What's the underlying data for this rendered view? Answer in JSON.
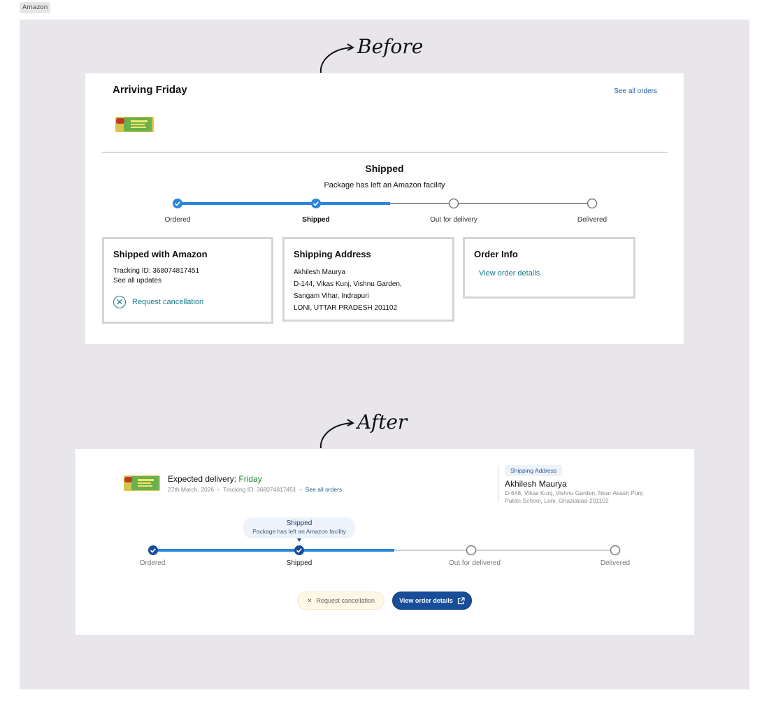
{
  "frame": {
    "label": "Amazon"
  },
  "notes": {
    "before": "Before",
    "after": "After"
  },
  "before": {
    "title": "Arriving Friday",
    "see_all": "See all orders",
    "status": "Shipped",
    "status_sub": "Package has left an Amazon facility",
    "steps": [
      {
        "label": "Ordered",
        "done": true
      },
      {
        "label": "Shipped",
        "done": true,
        "current": true
      },
      {
        "label": "Out for delivery",
        "done": false
      },
      {
        "label": "Delivered",
        "done": false
      }
    ],
    "shipped_box": {
      "title": "Shipped with Amazon",
      "tracking": "Tracking ID: 368074817451",
      "updates": "See all updates",
      "cancel": "Request cancellation"
    },
    "address_box": {
      "title": "Shipping Address",
      "lines": [
        "Akhilesh Maurya",
        "D-144, Vikas Kunj, Vishnu Garden,",
        "Sangam Vihar, Indrapuri",
        "LONI, UTTAR PRADESH 201102"
      ]
    },
    "order_box": {
      "title": "Order Info",
      "link": "View order details"
    }
  },
  "after": {
    "expected_prefix": "Expected delivery: ",
    "expected_day": "Friday",
    "date": "27th March, 2026",
    "tracking": "Tracking ID: 368074817451",
    "see_all": "See all orders",
    "address_pill": "Shipping Address",
    "name": "Akhilesh Maurya",
    "address": "D-648, Vikas Kunj, Vishnu Garden, Near Akash Punj Public School, Loni, Ghaziabad-201102",
    "bubble_title": "Shipped",
    "bubble_sub": "Package has left an Amazon facility",
    "steps": [
      {
        "label": "Ordered",
        "done": true
      },
      {
        "label": "Shipped",
        "done": true,
        "current": true
      },
      {
        "label": "Out for delivered",
        "done": false
      },
      {
        "label": "Delivered",
        "done": false
      }
    ],
    "cancel_label": "Request cancellation",
    "view_label": "View order details"
  },
  "colors": {
    "progress_blue": "#2b86d9",
    "after_blue": "#174d99",
    "green": "#1d8a2c",
    "link": "#2162a1"
  }
}
